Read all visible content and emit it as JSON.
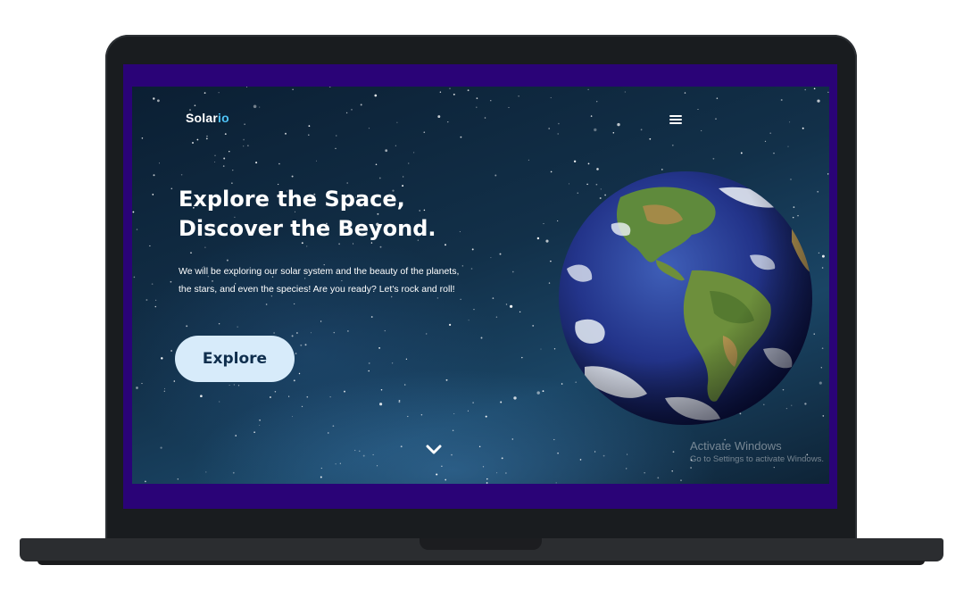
{
  "site": {
    "logo_main": "Solar",
    "logo_accent": "io",
    "accent_color": "#4fc3f7"
  },
  "nav": {
    "menu_icon": "hamburger-menu-icon"
  },
  "hero": {
    "headline_line1": "Explore the Space,",
    "headline_line2": "Discover the Beyond.",
    "description": "We will be exploring our solar system and the beauty of the planets, the stars, and even the species! Are you ready? Let's rock and roll!",
    "cta_label": "Explore",
    "cta_background": "#d7ebfa",
    "cta_text_color": "#0f2e4d",
    "scroll_icon": "chevron-down-icon",
    "image": "earth-globe"
  },
  "watermark": {
    "title": "Activate Windows",
    "subtitle": "Go to Settings to activate Windows."
  },
  "device": {
    "bezel_accent": "#2a0377",
    "frame_color": "#191c1f"
  }
}
